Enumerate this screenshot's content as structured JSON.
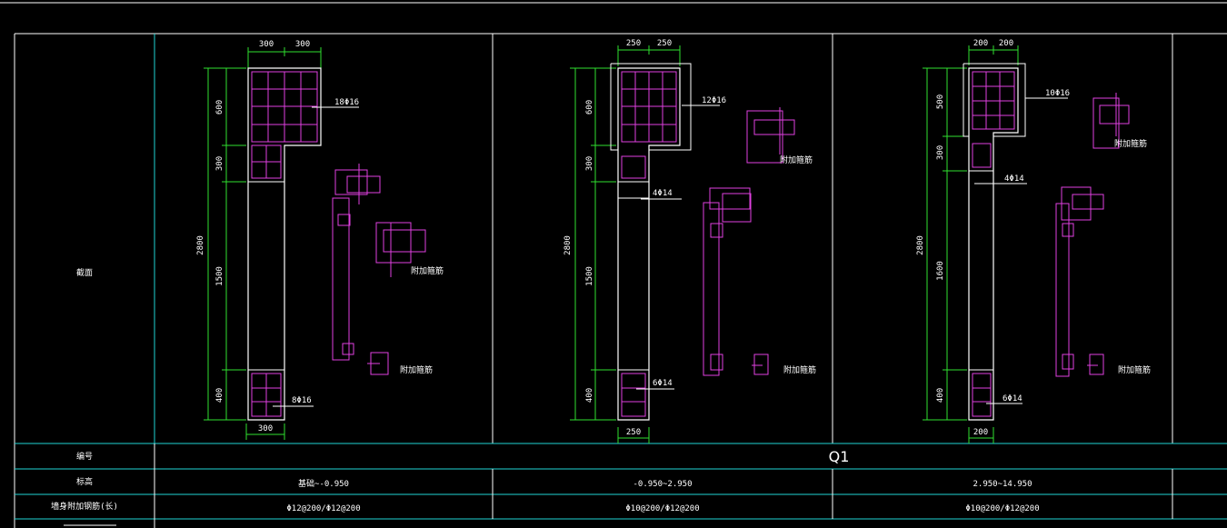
{
  "table": {
    "row_labels": {
      "section": "截面",
      "number": "编号",
      "elevation": "标高",
      "web_rebar": "墙身附加钢筋(长)"
    },
    "number_value": "Q1"
  },
  "sections": [
    {
      "top_dims": [
        "300",
        "300"
      ],
      "bottom_dim": "300",
      "left_dims": [
        "600",
        "300",
        "1500",
        "400"
      ],
      "total_dim": "2800",
      "top_rebar": "18Φ16",
      "bottom_rebar": "8Φ16",
      "detail_label": "附加箍筋",
      "elevation": "基础~-0.950",
      "web_rebar": "Φ12@200/Φ12@200"
    },
    {
      "top_dims": [
        "250",
        "250"
      ],
      "bottom_dim": "250",
      "left_dims": [
        "600",
        "300",
        "1500",
        "400"
      ],
      "total_dim": "2800",
      "top_rebar": "12Φ16",
      "mid_rebar": "4Φ14",
      "bottom_rebar": "6Φ14",
      "detail_label": "附加箍筋",
      "elevation": "-0.950~2.950",
      "web_rebar": "Φ10@200/Φ12@200"
    },
    {
      "top_dims": [
        "200",
        "200"
      ],
      "bottom_dim": "200",
      "left_dims": [
        "500",
        "300",
        "1600",
        "400"
      ],
      "total_dim": "2800",
      "top_rebar": "10Φ16",
      "mid_rebar": "4Φ14",
      "bottom_rebar": "6Φ14",
      "detail_label": "附加箍筋",
      "elevation": "2.950~14.950",
      "web_rebar": "Φ10@200/Φ12@200"
    }
  ]
}
